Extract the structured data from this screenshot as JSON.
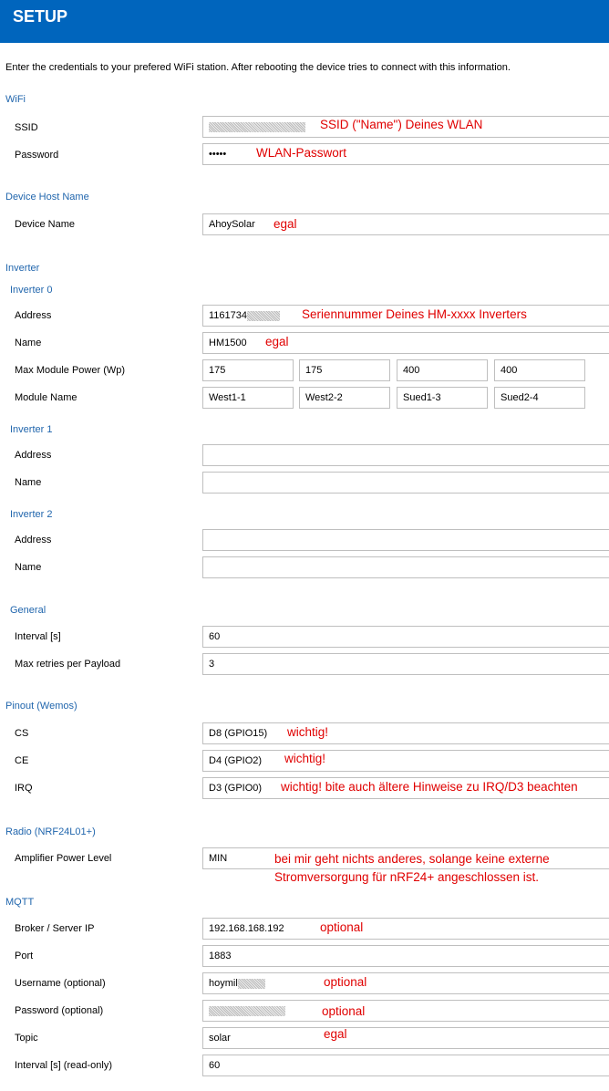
{
  "header": {
    "title": "SETUP"
  },
  "intro": "Enter the credentials to your prefered WiFi station. After rebooting the device tries to connect with this information.",
  "wifi": {
    "section": "WiFi",
    "ssid_label": "SSID",
    "ssid_note": "SSID (\"Name\") Deines WLAN",
    "password_label": "Password",
    "password_value": "•••••",
    "password_note": "WLAN-Passwort"
  },
  "device": {
    "section": "Device Host Name",
    "name_label": "Device Name",
    "name_value": "AhoySolar",
    "name_note": "egal"
  },
  "inverter": {
    "section": "Inverter",
    "inv0": {
      "heading": "Inverter 0",
      "address_label": "Address",
      "address_value": "1161734",
      "address_note": "Seriennummer Deines HM-xxxx Inverters",
      "name_label": "Name",
      "name_value": "HM1500",
      "name_note": "egal",
      "power_label": "Max Module Power (Wp)",
      "powers": [
        "175",
        "175",
        "400",
        "400"
      ],
      "module_label": "Module Name",
      "modules": [
        "West1-1",
        "West2-2",
        "Sued1-3",
        "Sued2-4"
      ]
    },
    "inv1": {
      "heading": "Inverter 1",
      "address_label": "Address",
      "name_label": "Name"
    },
    "inv2": {
      "heading": "Inverter 2",
      "address_label": "Address",
      "name_label": "Name"
    },
    "general": {
      "heading": "General",
      "interval_label": "Interval [s]",
      "interval_value": "60",
      "retries_label": "Max retries per Payload",
      "retries_value": "3"
    }
  },
  "pinout": {
    "section": "Pinout (Wemos)",
    "cs_label": "CS",
    "cs_value": "D8 (GPIO15)",
    "cs_note": "wichtig!",
    "ce_label": "CE",
    "ce_value": "D4 (GPIO2)",
    "ce_note": "wichtig!",
    "irq_label": "IRQ",
    "irq_value": "D3 (GPIO0)",
    "irq_note": "wichtig! bite auch ältere Hinweise zu IRQ/D3 beachten"
  },
  "radio": {
    "section": "Radio (NRF24L01+)",
    "amp_label": "Amplifier Power Level",
    "amp_value": "MIN",
    "amp_note_1": "bei mir geht nichts anderes, solange keine externe",
    "amp_note_2": "Stromversorgung für nRF24+ angeschlossen ist."
  },
  "mqtt": {
    "section": "MQTT",
    "broker_label": "Broker / Server IP",
    "broker_value": "192.168.168.192",
    "broker_note": "optional",
    "port_label": "Port",
    "port_value": "1883",
    "user_label": "Username (optional)",
    "user_value": "hoymil",
    "user_note": "optional",
    "pass_label": "Password (optional)",
    "pass_note": "optional",
    "topic_label": "Topic",
    "topic_value": "solar",
    "topic_note": "egal",
    "interval_label": "Interval [s] (read-only)",
    "interval_value": "60"
  }
}
